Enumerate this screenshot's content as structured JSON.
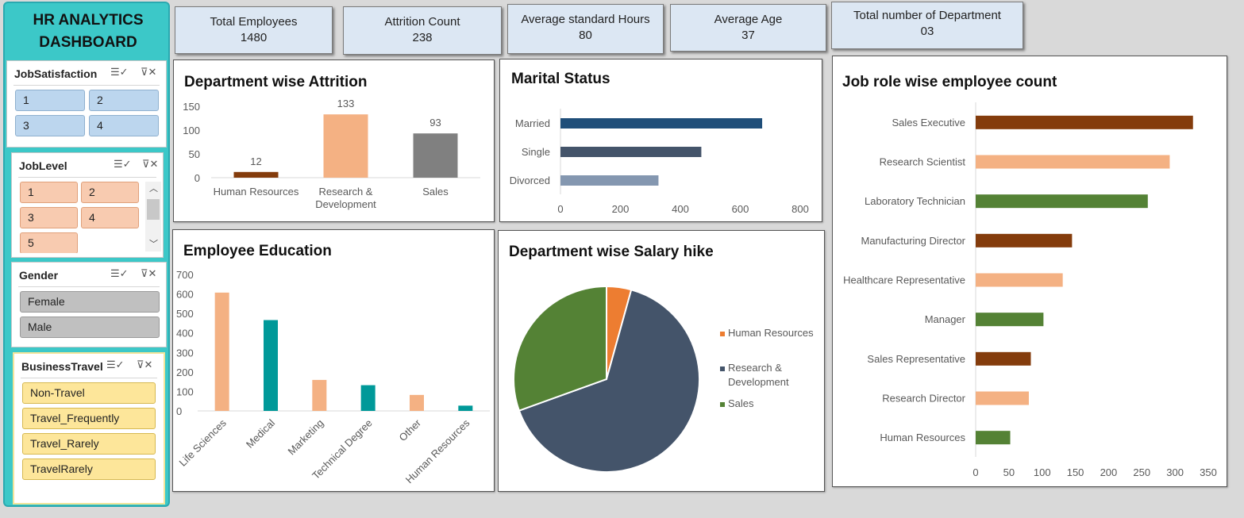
{
  "dashboard": {
    "title_line1": "HR ANALYTICS",
    "title_line2": "DASHBOARD"
  },
  "slicers": {
    "job_satisfaction": {
      "title": "JobSatisfaction",
      "items": [
        "1",
        "2",
        "3",
        "4"
      ]
    },
    "job_level": {
      "title": "JobLevel",
      "items": [
        "1",
        "2",
        "3",
        "4",
        "5"
      ]
    },
    "gender": {
      "title": "Gender",
      "items": [
        "Female",
        "Male"
      ]
    },
    "business_travel": {
      "title": "BusinessTravel",
      "items": [
        "Non-Travel",
        "Travel_Frequently",
        "Travel_Rarely",
        "TravelRarely"
      ]
    }
  },
  "kpis": [
    {
      "label": "Total Employees",
      "value": "1480"
    },
    {
      "label": "Attrition Count",
      "value": "238"
    },
    {
      "label": "Average standard Hours",
      "value": "80"
    },
    {
      "label": "Average Age",
      "value": "37"
    },
    {
      "label": "Total number of Department",
      "value": "03"
    }
  ],
  "colors": {
    "brown": "#843c0c",
    "peach": "#f4b183",
    "gray": "#808080",
    "navy": "#1f4e79",
    "slate": "#44546a",
    "lightslate": "#8497b0",
    "teal": "#009999",
    "orange": "#ed7d31",
    "green": "#548235"
  },
  "chart_data": [
    {
      "type": "bar",
      "title": "Department wise Attrition",
      "categories": [
        "Human Resources",
        "Research & Development",
        "Sales"
      ],
      "values": [
        12,
        133,
        93
      ],
      "data_labels": [
        "12",
        "133",
        "93"
      ],
      "yticks": [
        "0",
        "50",
        "100",
        "150"
      ],
      "ylim": [
        0,
        150
      ]
    },
    {
      "type": "bar",
      "orientation": "horizontal",
      "title": "Marital Status",
      "categories": [
        "Married",
        "Single",
        "Divorced"
      ],
      "values": [
        673,
        470,
        327
      ],
      "xticks": [
        "0",
        "200",
        "400",
        "600",
        "800"
      ],
      "xlim": [
        0,
        800
      ]
    },
    {
      "type": "bar",
      "orientation": "horizontal",
      "title": "Job role wise employee count",
      "categories": [
        "Sales Executive",
        "Research Scientist",
        "Laboratory Technician",
        "Manufacturing Director",
        "Healthcare Representative",
        "Manager",
        "Sales Representative",
        "Research Director",
        "Human Resources"
      ],
      "values": [
        327,
        292,
        259,
        145,
        131,
        102,
        83,
        80,
        52
      ],
      "xticks": [
        "0",
        "50",
        "100",
        "150",
        "200",
        "250",
        "300",
        "350"
      ],
      "xlim": [
        0,
        350
      ]
    },
    {
      "type": "bar",
      "title": "Employee Education",
      "categories": [
        "Life Sciences",
        "Medical",
        "Marketing",
        "Technical Degree",
        "Other",
        "Human Resources"
      ],
      "values": [
        607,
        466,
        159,
        132,
        82,
        27
      ],
      "yticks": [
        "0",
        "100",
        "200",
        "300",
        "400",
        "500",
        "600",
        "700"
      ],
      "ylim": [
        0,
        700
      ]
    },
    {
      "type": "pie",
      "title": "Department wise Salary hike",
      "labels": [
        "Human Resources",
        "Research & Development",
        "Sales"
      ],
      "legend_lines": [
        [
          "Human Resources"
        ],
        [
          "Research &",
          "Development"
        ],
        [
          "Sales"
        ]
      ],
      "values": [
        4.3,
        65.2,
        30.5
      ],
      "legend": "right"
    }
  ]
}
